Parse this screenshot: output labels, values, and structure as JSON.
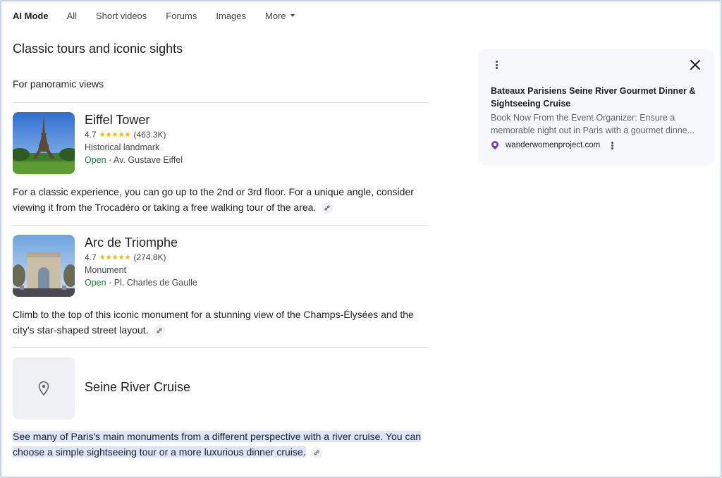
{
  "tabs": [
    {
      "label": "AI Mode",
      "active": true
    },
    {
      "label": "All"
    },
    {
      "label": "Short videos"
    },
    {
      "label": "Forums"
    },
    {
      "label": "Images"
    },
    {
      "label": "More"
    }
  ],
  "heading": "Classic tours and iconic sights",
  "subheading": "For panoramic views",
  "places": [
    {
      "name": "Eiffel Tower",
      "rating": "4.7",
      "stars": "★★★★★",
      "reviews": "(463.3K)",
      "category": "Historical landmark",
      "status": "Open",
      "address": " · Av. Gustave Eiffel",
      "thumb_icon": "eiffel-tower-photo",
      "description": "For a classic experience, you can go up to the 2nd or 3rd floor. For a unique angle, consider viewing it from the Trocadéro or taking a free walking tour of the area."
    },
    {
      "name": "Arc de Triomphe",
      "rating": "4.7",
      "stars": "★★★★★",
      "reviews": "(274.8K)",
      "category": "Monument",
      "status": "Open",
      "address": " · Pl. Charles de Gaulle",
      "thumb_icon": "arc-de-triomphe-photo",
      "description": "Climb to the top of this iconic monument for a stunning view of the Champs-Élysées and the city's star-shaped street layout."
    },
    {
      "name": "Seine River Cruise",
      "thumb_icon": "map-pin-icon",
      "description": "See many of Paris's main monuments from a different perspective with a river cruise. You can choose a simple sightseeing tour or a more luxurious dinner cruise.",
      "highlighted": true
    }
  ],
  "side_card": {
    "title": "Bateaux Parisiens Seine River Gourmet Dinner & Sightseeing Cruise",
    "description": "Book Now From the Event Organizer: Ensure a memorable night out in Paris with a gourmet dinne...",
    "source": "wanderwomenproject.com",
    "favicon_color": "#7b3fb8"
  },
  "colors": {
    "open": "#188038",
    "star": "#f5b400",
    "highlight": "#dbe6fb",
    "card_bg": "#f6f8fc"
  }
}
